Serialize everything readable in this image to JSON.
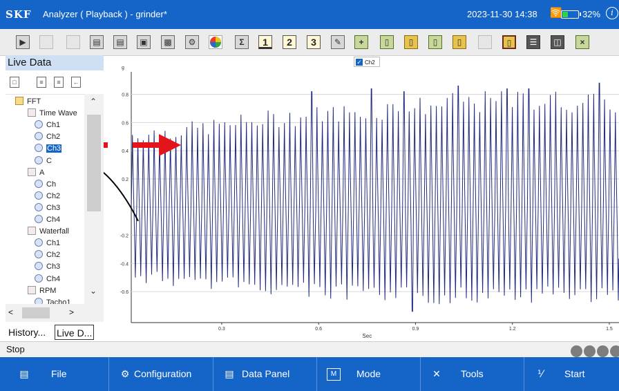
{
  "titlebar": {
    "logo": "SKF",
    "title": "Analyzer ( Playback ) - grinder*",
    "datetime": "2023-11-30 14:38",
    "battery": "32%",
    "info_glyph": "i"
  },
  "toolbar": {
    "icons": [
      "play-icon",
      "stop-icon",
      "record-icon",
      "open-folder-icon",
      "folder-icon",
      "save-icon",
      "report-icon",
      "gear-icon",
      "pie-chart-icon",
      "sigma-icon",
      "one-plot-icon",
      "two-plot-icon",
      "three-plot-icon",
      "export-icon",
      "add-cursor-icon",
      "cursor-a-icon",
      "cursor-b-icon",
      "cursor-c-icon",
      "cursor-d-icon",
      "blank-icon",
      "layout-icon",
      "split-horizontal-icon",
      "split-vertical-icon",
      "close-plot-icon"
    ],
    "labels": {
      "one": "1",
      "two": "2",
      "three": "3"
    }
  },
  "left_panel": {
    "header": "Live Data",
    "tree": [
      {
        "label": "FFT",
        "type": "folder",
        "level": 1
      },
      {
        "label": "Time Wave",
        "type": "group",
        "level": 2
      },
      {
        "label": "Ch1",
        "type": "channel",
        "level": 3
      },
      {
        "label": "Ch2",
        "type": "channel",
        "level": 3
      },
      {
        "label": "Ch3",
        "type": "channel",
        "level": 3,
        "selected": true
      },
      {
        "label": "C",
        "type": "channel",
        "level": 3
      },
      {
        "label": "A",
        "type": "group",
        "level": 2
      },
      {
        "label": "Ch",
        "type": "channel",
        "level": 3
      },
      {
        "label": "Ch2",
        "type": "channel",
        "level": 3
      },
      {
        "label": "Ch3",
        "type": "channel",
        "level": 3
      },
      {
        "label": "Ch4",
        "type": "channel",
        "level": 3
      },
      {
        "label": "Waterfall",
        "type": "group",
        "level": 2
      },
      {
        "label": "Ch1",
        "type": "channel",
        "level": 3
      },
      {
        "label": "Ch2",
        "type": "channel",
        "level": 3
      },
      {
        "label": "Ch3",
        "type": "channel",
        "level": 3
      },
      {
        "label": "Ch4",
        "type": "channel",
        "level": 3
      },
      {
        "label": "RPM",
        "type": "group",
        "level": 2
      },
      {
        "label": "Tacho1",
        "type": "channel",
        "level": 3
      }
    ],
    "tabs": [
      {
        "label": "History...",
        "active": false
      },
      {
        "label": "Live D...",
        "active": true
      }
    ]
  },
  "status": {
    "text": "Stop"
  },
  "bottom_nav": [
    {
      "label": "File",
      "icon": "folder-icon"
    },
    {
      "label": "Configuration",
      "icon": "configuration-icon"
    },
    {
      "label": "Data Panel",
      "icon": "data-panel-icon"
    },
    {
      "label": "Mode",
      "icon": "mode-icon"
    },
    {
      "label": "Tools",
      "icon": "tools-icon"
    },
    {
      "label": "Start",
      "icon": "start-icon"
    }
  ],
  "chart_data": {
    "type": "line",
    "legend": "Ch2",
    "legend_checked": true,
    "ylabel": "g",
    "xlabel": "Sec",
    "xlim": [
      0.02,
      1.53
    ],
    "ylim": [
      -0.82,
      0.96
    ],
    "x_ticks": [
      0.3,
      0.6,
      0.9,
      1.2,
      1.5
    ],
    "y_ticks": [
      -0.6,
      -0.4,
      -0.2,
      0,
      0.2,
      0.4,
      0.6,
      0.8
    ],
    "x_tick_labels": [
      "0.3",
      "0.6",
      "0.9",
      "1.2",
      "1.5"
    ],
    "y_tick_labels": [
      "-0.6",
      "-0.4",
      "-0.2",
      "",
      "0.2",
      "0.4",
      "0.6",
      "0.8"
    ],
    "grid": "horizontal",
    "line_color": "#1f2a7a",
    "cycle_period_s": 0.0168,
    "envelope_peaks": [
      {
        "x": 0.02,
        "max": 0.54,
        "min": -0.52
      },
      {
        "x": 0.2,
        "max": 0.58,
        "min": -0.55
      },
      {
        "x": 0.45,
        "max": 0.66,
        "min": -0.6
      },
      {
        "x": 0.75,
        "max": 0.72,
        "min": -0.66
      },
      {
        "x": 1.05,
        "max": 0.78,
        "min": -0.66
      },
      {
        "x": 1.3,
        "max": 0.8,
        "min": -0.66
      },
      {
        "x": 1.53,
        "max": 0.76,
        "min": -0.64
      }
    ],
    "spikes": [
      {
        "x": 0.58,
        "y": 0.82
      },
      {
        "x": 0.76,
        "y": 0.84
      },
      {
        "x": 0.86,
        "y": 0.82
      },
      {
        "x": 0.89,
        "y": -0.74
      },
      {
        "x": 1.03,
        "y": 0.86
      },
      {
        "x": 1.18,
        "y": 0.84
      },
      {
        "x": 1.25,
        "y": 0.84
      },
      {
        "x": 1.47,
        "y": 0.88
      }
    ]
  },
  "annotation": {
    "arrow_color": "#e4141b",
    "stroke_color": "#000000"
  }
}
